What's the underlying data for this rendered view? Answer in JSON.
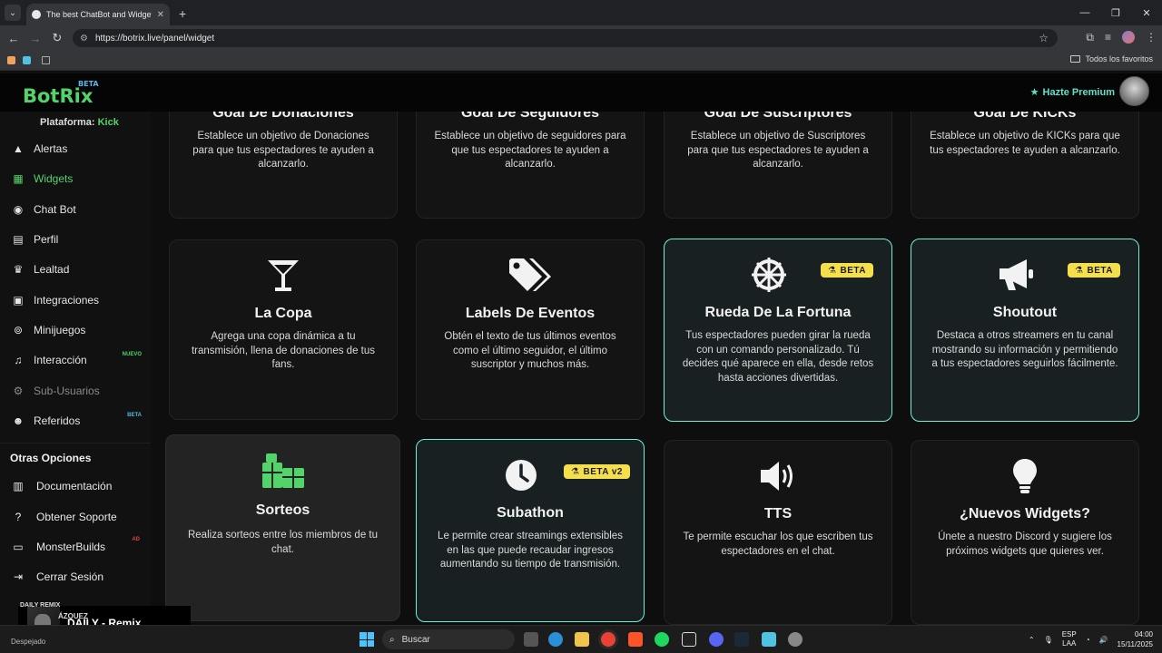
{
  "browser": {
    "tab_title": "The best ChatBot and Widgets",
    "url": "https://botrix.live/panel/widget",
    "bookmarks_all_label": "Todos los favoritos"
  },
  "site": {
    "logo": "BotRix",
    "logo_badge": "BETA",
    "premium_label": "Hazte Premium",
    "accent": "#53d46a",
    "highlight_border": "#6ff0d6"
  },
  "sidebar": {
    "platform_label": "Plataforma:",
    "platform_value": "Kick",
    "items": [
      {
        "label": "Alertas",
        "icon": "warning-icon"
      },
      {
        "label": "Widgets",
        "icon": "grid-icon",
        "active": true
      },
      {
        "label": "Chat Bot",
        "icon": "robot-icon"
      },
      {
        "label": "Perfil",
        "icon": "id-card-icon"
      },
      {
        "label": "Lealtad",
        "icon": "trophy-icon"
      },
      {
        "label": "Integraciones",
        "icon": "plug-icon"
      },
      {
        "label": "Minijuegos",
        "icon": "gamepad-icon"
      },
      {
        "label": "Interacción",
        "icon": "music-icon",
        "badge": "NUEVO"
      },
      {
        "label": "Sub-Usuarios",
        "icon": "users-gear-icon",
        "muted": true
      },
      {
        "label": "Referidos",
        "icon": "users-icon",
        "badge": "BETA"
      }
    ],
    "other_title": "Otras Opciones",
    "other_items": [
      {
        "label": "Documentación",
        "icon": "docs-icon"
      },
      {
        "label": "Obtener Soporte",
        "icon": "help-icon"
      },
      {
        "label": "MonsterBuilds",
        "icon": "laptop-icon",
        "badge": "AD"
      },
      {
        "label": "Cerrar Sesión",
        "icon": "logout-icon"
      }
    ]
  },
  "cards": [
    {
      "title": "Goal De Donaciones",
      "desc": "Establece un objetivo de Donaciones para que tus espectadores te ayuden a alcanzarlo."
    },
    {
      "title": "Goal De Seguidores",
      "desc": "Establece un objetivo de seguidores para que tus espectadores te ayuden a alcanzarlo."
    },
    {
      "title": "Goal De Suscriptores",
      "desc": "Establece un objetivo de Suscriptores para que tus espectadores te ayuden a alcanzarlo."
    },
    {
      "title": "Goal De KICKs",
      "desc": "Establece un objetivo de KICKs para que tus espectadores te ayuden a alcanzarlo."
    },
    {
      "title": "La Copa",
      "desc": "Agrega una copa dinámica a tu transmisión, llena de donaciones de tus fans.",
      "icon": "cocktail-icon"
    },
    {
      "title": "Labels De Eventos",
      "desc": "Obtén el texto de tus últimos eventos como el último seguidor, el último suscriptor y muchos más.",
      "icon": "tags-icon"
    },
    {
      "title": "Rueda De La Fortuna",
      "desc": "Tus espectadores pueden girar la rueda con un comando personalizado. Tú decides qué aparece en ella, desde retos hasta acciones divertidas.",
      "icon": "wheel-icon",
      "badge": "BETA"
    },
    {
      "title": "Shoutout",
      "desc": "Destaca a otros streamers en tu canal mostrando su información y permitiendo a tus espectadores seguirlos fácilmente.",
      "icon": "megaphone-icon",
      "badge": "BETA"
    },
    {
      "title": "Sorteos",
      "desc": "Realiza sorteos entre los miembros de tu chat.",
      "icon": "gifts-icon"
    },
    {
      "title": "Subathon",
      "desc": "Le permite crear streamings extensibles en las que puede recaudar ingresos aumentando su tiempo de transmisión.",
      "icon": "clock-icon",
      "badge": "BETA v2"
    },
    {
      "title": "TTS",
      "desc": "Te permite escuchar los que escriben tus espectadores en el chat.",
      "icon": "volume-icon"
    },
    {
      "title": "¿Nuevos Widgets?",
      "desc": "Únete a nuestro Discord y sugiere los próximos widgets que quieres ver.",
      "icon": "lightbulb-icon"
    }
  ],
  "now_playing": {
    "top_label": "DAILY REMIX",
    "artist_fragment": "ÁZQUEZ",
    "title": "DAILY - Remix"
  },
  "taskbar": {
    "search_placeholder": "Buscar",
    "lang_top": "ESP",
    "lang_bottom": "LAA",
    "time": "04:00",
    "date": "15/11/2025",
    "weather": "Despejado"
  }
}
